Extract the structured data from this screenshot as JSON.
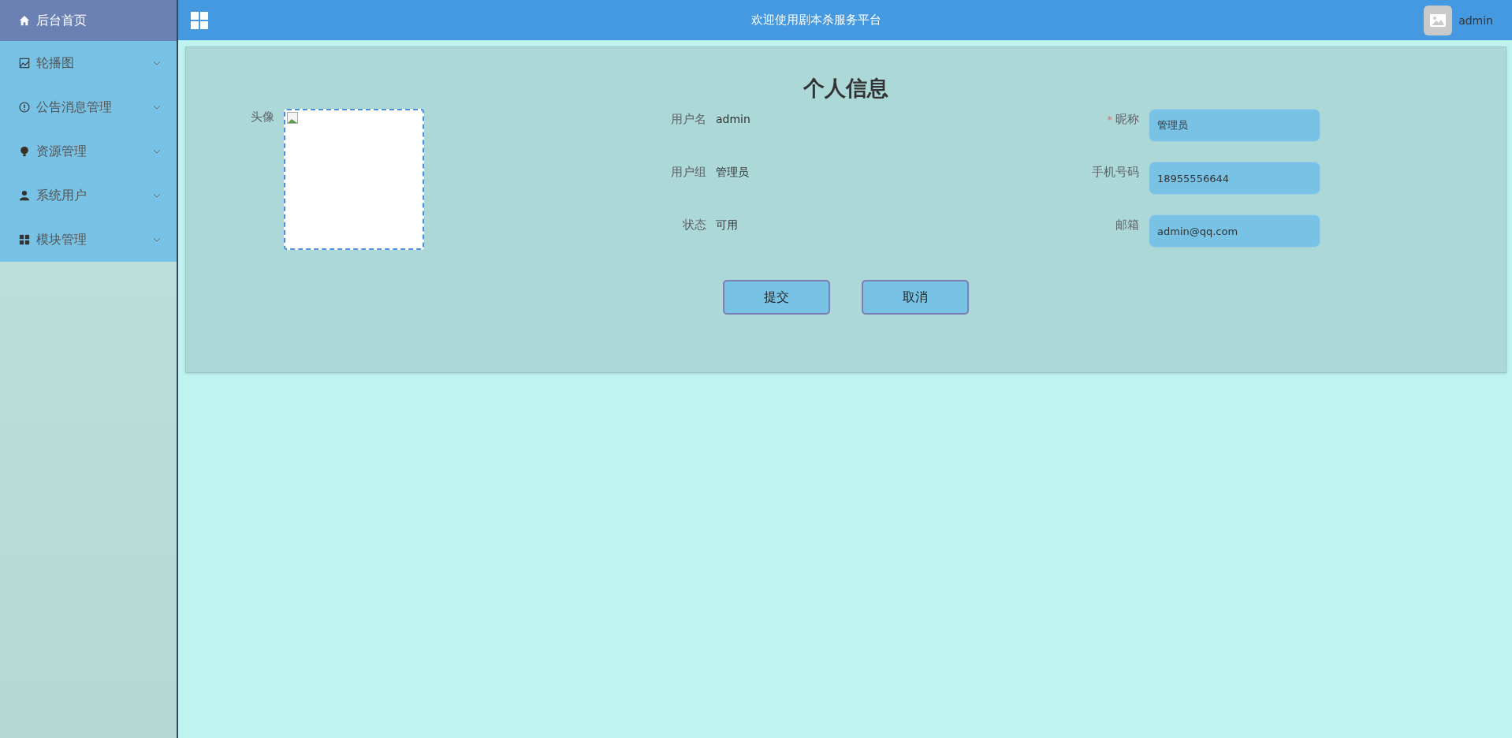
{
  "sidebar": {
    "items": [
      {
        "label": "后台首页",
        "kind": "home",
        "selected": true,
        "has_submenu": false
      },
      {
        "label": "轮播图",
        "kind": "image",
        "selected": false,
        "has_submenu": true
      },
      {
        "label": "公告消息管理",
        "kind": "info",
        "selected": false,
        "has_submenu": true
      },
      {
        "label": "资源管理",
        "kind": "bulb",
        "selected": false,
        "has_submenu": true
      },
      {
        "label": "系统用户",
        "kind": "user",
        "selected": false,
        "has_submenu": true
      },
      {
        "label": "模块管理",
        "kind": "grid",
        "selected": false,
        "has_submenu": true
      }
    ]
  },
  "header": {
    "title": "欢迎使用剧本杀服务平台",
    "user": "admin"
  },
  "profile": {
    "title": "个人信息",
    "avatar_label": "头像",
    "info": [
      {
        "label": "用户名",
        "value": "admin"
      },
      {
        "label": "用户组",
        "value": "管理员"
      },
      {
        "label": "状态",
        "value": "可用"
      }
    ],
    "required_mark": "*",
    "fields": [
      {
        "label": "昵称",
        "value": "管理员",
        "required": true
      },
      {
        "label": "手机号码",
        "value": "18955556644",
        "required": false
      },
      {
        "label": "邮箱",
        "value": "admin@qq.com",
        "required": false
      }
    ],
    "buttons": [
      "提交",
      "取消"
    ]
  }
}
